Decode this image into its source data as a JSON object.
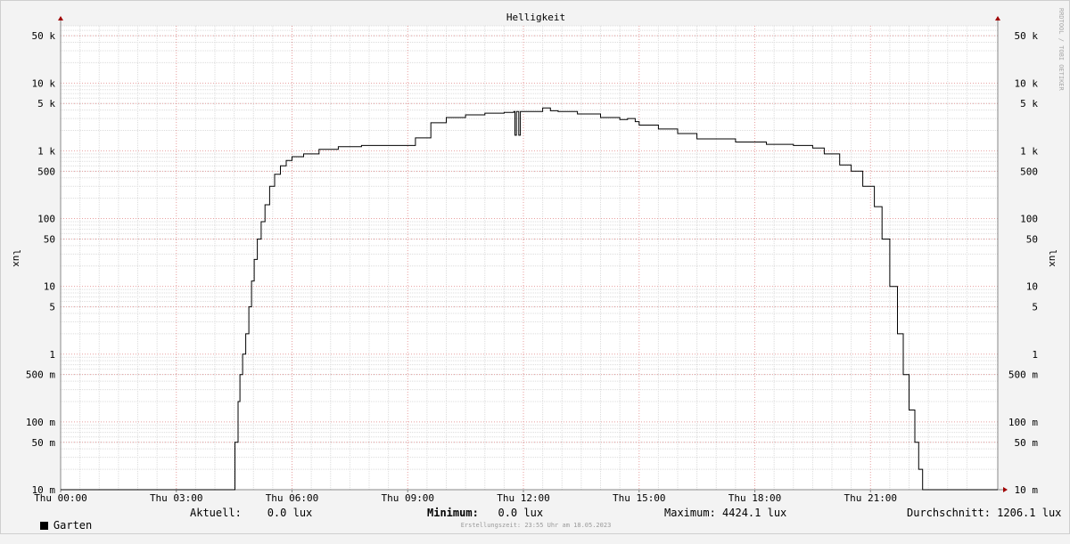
{
  "chart_data": {
    "type": "line",
    "title": "Helligkeit",
    "ylabel": "lux",
    "xlabel": "",
    "yscale": "log",
    "ylim": [
      0.01,
      70000
    ],
    "xlim_hours": [
      0,
      24.3
    ],
    "grid": true,
    "x_ticks": [
      {
        "h": 0,
        "label": "Thu 00:00"
      },
      {
        "h": 3,
        "label": "Thu 03:00"
      },
      {
        "h": 6,
        "label": "Thu 06:00"
      },
      {
        "h": 9,
        "label": "Thu 09:00"
      },
      {
        "h": 12,
        "label": "Thu 12:00"
      },
      {
        "h": 15,
        "label": "Thu 15:00"
      },
      {
        "h": 18,
        "label": "Thu 18:00"
      },
      {
        "h": 21,
        "label": "Thu 21:00"
      }
    ],
    "y_ticks": [
      {
        "v": 0.01,
        "label": "10 m"
      },
      {
        "v": 0.05,
        "label": "50 m"
      },
      {
        "v": 0.1,
        "label": "100 m"
      },
      {
        "v": 0.5,
        "label": "500 m"
      },
      {
        "v": 1,
        "label": "1"
      },
      {
        "v": 5,
        "label": "5"
      },
      {
        "v": 10,
        "label": "10"
      },
      {
        "v": 50,
        "label": "50"
      },
      {
        "v": 100,
        "label": "100"
      },
      {
        "v": 500,
        "label": "500"
      },
      {
        "v": 1000,
        "label": "1 k"
      },
      {
        "v": 5000,
        "label": "5 k"
      },
      {
        "v": 10000,
        "label": "10 k"
      },
      {
        "v": 50000,
        "label": "50 k"
      }
    ],
    "series": [
      {
        "name": "Garten",
        "color": "#000000",
        "x": [
          0,
          4.5,
          4.52,
          4.6,
          4.65,
          4.72,
          4.8,
          4.88,
          4.95,
          5.02,
          5.1,
          5.2,
          5.3,
          5.42,
          5.55,
          5.7,
          5.85,
          6.0,
          6.3,
          6.7,
          7.2,
          7.8,
          8.5,
          9.2,
          9.6,
          10.0,
          10.5,
          11.0,
          11.5,
          11.75,
          11.78,
          11.82,
          11.88,
          11.92,
          11.97,
          12.05,
          12.5,
          12.7,
          12.9,
          13.4,
          14.0,
          14.5,
          14.7,
          14.9,
          15.0,
          15.5,
          16.0,
          16.5,
          17.5,
          18.3,
          19.0,
          19.5,
          19.8,
          20.2,
          20.5,
          20.8,
          21.1,
          21.3,
          21.5,
          21.7,
          21.85,
          22.0,
          22.15,
          22.25,
          22.35,
          22.4,
          22.42,
          24.3
        ],
        "y": [
          0.01,
          0.01,
          0.05,
          0.2,
          0.5,
          1,
          2,
          5,
          12,
          25,
          50,
          90,
          160,
          300,
          450,
          600,
          720,
          820,
          900,
          1050,
          1150,
          1200,
          1200,
          1550,
          2600,
          3100,
          3400,
          3600,
          3700,
          3800,
          1700,
          3800,
          1700,
          3800,
          3800,
          3800,
          4300,
          3900,
          3800,
          3500,
          3100,
          2900,
          3000,
          2700,
          2400,
          2100,
          1800,
          1500,
          1350,
          1250,
          1200,
          1100,
          900,
          620,
          500,
          300,
          150,
          50,
          10,
          2,
          0.5,
          0.15,
          0.05,
          0.02,
          0.01,
          0.01,
          0.01,
          0.01
        ]
      }
    ]
  },
  "legend": {
    "series_name": "Garten",
    "aktuell": "Aktuell:    0.0 lux",
    "minimum_label": "Minimum:",
    "minimum_value": "   0.0 lux",
    "maximum": "Maximum: 4424.1 lux",
    "durchschnitt": "Durchschnitt: 1206.1 lux"
  },
  "footer": "Erstellungszeit: 23:55 Uhr am 18.05.2023",
  "watermark": "RRDTOOL / TOBI OETIKER"
}
